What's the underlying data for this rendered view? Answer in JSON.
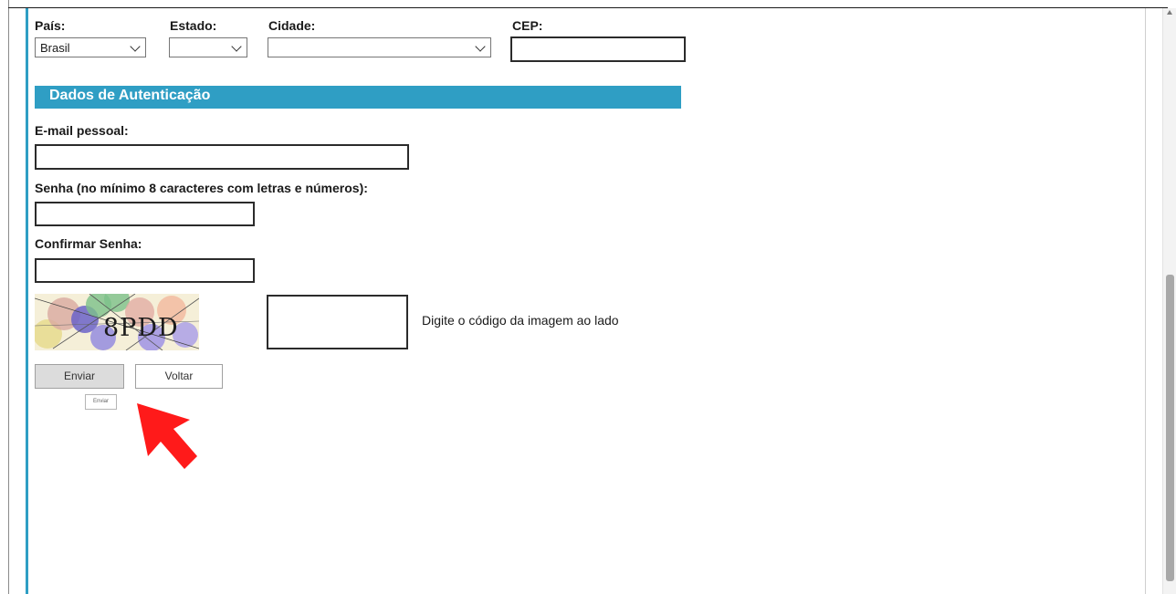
{
  "location": {
    "country_label": "País:",
    "country_value": "Brasil",
    "state_label": "Estado:",
    "state_value": "",
    "city_label": "Cidade:",
    "city_value": "",
    "cep_label": "CEP:",
    "cep_value": ""
  },
  "auth": {
    "section_title": "Dados de Autenticação",
    "email_label": "E-mail pessoal:",
    "password_label": "Senha (no mínimo 8 caracteres com letras e números):",
    "confirm_label": "Confirmar Senha:"
  },
  "captcha": {
    "image_text": "8PDD",
    "hint": "Digite o código da imagem ao lado"
  },
  "buttons": {
    "send": "Enviar",
    "back": "Voltar",
    "tiny_send": "Enviar"
  },
  "colors": {
    "accent": "#2f9ec4",
    "arrow": "#ff1a1a"
  },
  "icons": [
    "chevron-down-icon",
    "red-arrow-icon"
  ]
}
